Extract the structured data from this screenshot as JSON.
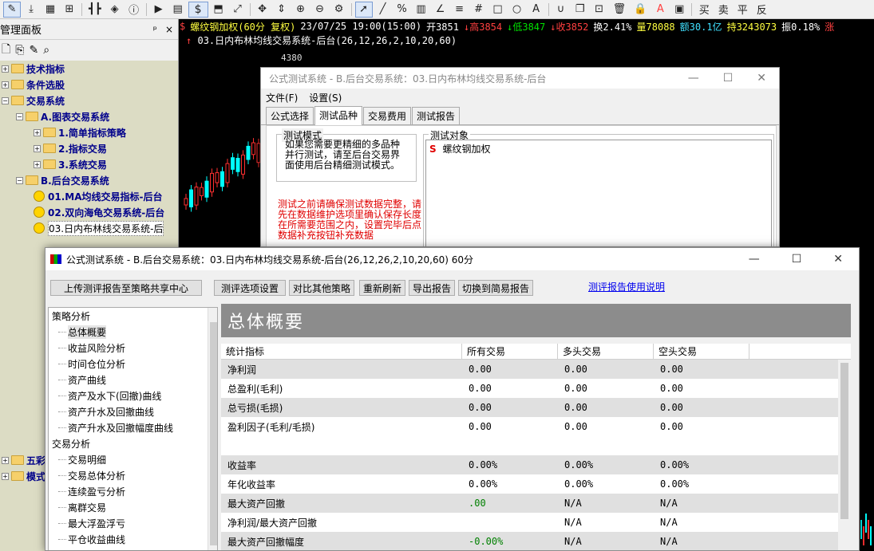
{
  "toolbar": {
    "symbol_text": "$",
    "right_items": [
      "买",
      "卖",
      "平",
      "反"
    ]
  },
  "left_panel": {
    "title": "管理面板",
    "pin": "ᵖ",
    "close": "×",
    "tree": [
      {
        "label": "技术指标",
        "type": "folder",
        "level": 0
      },
      {
        "label": "条件选股",
        "type": "folder",
        "level": 0
      },
      {
        "label": "交易系统",
        "type": "folder",
        "level": 0
      },
      {
        "label": "A.图表交易系统",
        "type": "folder",
        "level": 1
      },
      {
        "label": "1.简单指标策略",
        "type": "folder",
        "level": 2
      },
      {
        "label": "2.指标交易",
        "type": "folder",
        "level": 2
      },
      {
        "label": "3.系统交易",
        "type": "folder",
        "level": 2
      },
      {
        "label": "B.后台交易系统",
        "type": "folder",
        "level": 1
      },
      {
        "label": "01.MA均线交易指标-后台",
        "type": "smile",
        "level": 2
      },
      {
        "label": "02.双向海龟交易系统-后台",
        "type": "smile",
        "level": 2
      },
      {
        "label": "03.日内布林线交易系统-后",
        "type": "smile",
        "level": 2,
        "selected": true
      }
    ],
    "bottom_items": [
      {
        "label": "五彩",
        "type": "folder"
      },
      {
        "label": "模式",
        "type": "folder"
      }
    ]
  },
  "chart": {
    "symbol": "螺纹钢加权(60分 复权)",
    "datetime": "23/07/25 19:00(15:00)",
    "open": "开3851",
    "high": "高3854",
    "low": "低3847",
    "close": "收3852",
    "turnover_rate": "换2.41%",
    "volume": "量78088",
    "amount": "额30.1亿",
    "open_interest": "持3243073",
    "amplitude": "振0.18%",
    "change": "涨",
    "system_line": "03.日内布林均线交易系统-后台(26,12,26,2,10,20,60)",
    "price_label": "4380"
  },
  "back_dialog": {
    "title": "公式测试系统 - B.后台交易系统：03.日内布林均线交易系统-后台",
    "menu": [
      "文件(F)",
      "设置(S)"
    ],
    "tabs": [
      "公式选择",
      "测试品种",
      "交易费用",
      "测试报告"
    ],
    "mode_label": "测试模式",
    "mode_text": "如果您需要更精细的多品种并行测试，请至后台交易界面使用后台精细测试模式。",
    "warning": "测试之前请确保测试数据完整，请先在数据维护选项里确认保存长度在所需要范围之内，设置完毕后点数据补充按钮补充数据",
    "target_label": "测试对象",
    "target_item": "螺纹钢加权",
    "target_icon": "S"
  },
  "main_dialog": {
    "title": "公式测试系统 - B.后台交易系统：03.日内布林均线交易系统-后台(26,12,26,2,10,20,60) 60分",
    "buttons": [
      "上传测评报告至策略共享中心",
      "测评选项设置",
      "对比其他策略",
      "重新刷新",
      "导出报告",
      "切换到简易报告"
    ],
    "help_link": "测评报告使用说明",
    "nav": [
      {
        "label": "策略分析",
        "type": "cat"
      },
      {
        "label": "总体概要",
        "type": "sub",
        "active": true
      },
      {
        "label": "收益风险分析",
        "type": "sub"
      },
      {
        "label": "时间仓位分析",
        "type": "sub"
      },
      {
        "label": "资产曲线",
        "type": "sub"
      },
      {
        "label": "资产及水下(回撤)曲线",
        "type": "sub"
      },
      {
        "label": "资产升水及回撤曲线",
        "type": "sub"
      },
      {
        "label": "资产升水及回撤幅度曲线",
        "type": "sub"
      },
      {
        "label": "交易分析",
        "type": "cat"
      },
      {
        "label": "交易明细",
        "type": "sub"
      },
      {
        "label": "交易总体分析",
        "type": "sub"
      },
      {
        "label": "连续盈亏分析",
        "type": "sub"
      },
      {
        "label": "离群交易",
        "type": "sub"
      },
      {
        "label": "最大浮盈浮亏",
        "type": "sub"
      },
      {
        "label": "平仓收益曲线",
        "type": "sub"
      }
    ],
    "banner": "总体概要",
    "columns": [
      "统计指标",
      "所有交易",
      "多头交易",
      "空头交易"
    ],
    "rows": [
      {
        "name": "净利润",
        "all": "0.00",
        "long": "0.00",
        "short": "0.00",
        "shade": true
      },
      {
        "name": "总盈利(毛利)",
        "all": "0.00",
        "long": "0.00",
        "short": "0.00",
        "shade": false
      },
      {
        "name": "总亏损(毛损)",
        "all": "0.00",
        "long": "0.00",
        "short": "0.00",
        "shade": true
      },
      {
        "name": "盈利因子(毛利/毛损)",
        "all": "0.00",
        "long": "0.00",
        "short": "0.00",
        "shade": false
      },
      {
        "name": "",
        "all": "",
        "long": "",
        "short": "",
        "shade": false
      },
      {
        "name": "收益率",
        "all": "0.00%",
        "long": "0.00%",
        "short": "0.00%",
        "shade": true
      },
      {
        "name": "年化收益率",
        "all": "0.00%",
        "long": "0.00%",
        "short": "0.00%",
        "shade": false
      },
      {
        "name": "最大资产回撤",
        "all": ".00",
        "long": "N/A",
        "short": "N/A",
        "shade": true,
        "all_green": true
      },
      {
        "name": "净利润/最大资产回撤",
        "all": "",
        "long": "N/A",
        "short": "N/A",
        "shade": false
      },
      {
        "name": "最大资产回撤幅度",
        "all": "-0.00%",
        "long": "N/A",
        "short": "N/A",
        "shade": true,
        "all_green": true
      }
    ]
  }
}
